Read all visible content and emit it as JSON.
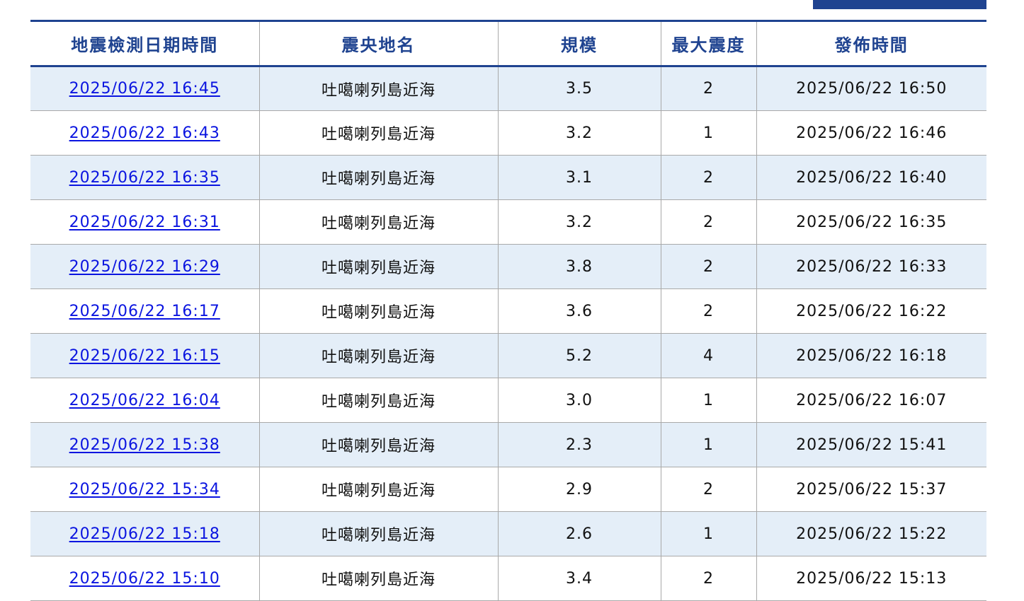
{
  "table": {
    "headers": [
      "地震檢測日期時間",
      "震央地名",
      "規模",
      "最大震度",
      "發佈時間"
    ],
    "rows": [
      {
        "detect_time": "2025/06/22 16:45",
        "location": "吐噶喇列島近海",
        "magnitude": "3.5",
        "max_intensity": "2",
        "publish_time": "2025/06/22 16:50"
      },
      {
        "detect_time": "2025/06/22 16:43",
        "location": "吐噶喇列島近海",
        "magnitude": "3.2",
        "max_intensity": "1",
        "publish_time": "2025/06/22 16:46"
      },
      {
        "detect_time": "2025/06/22 16:35",
        "location": "吐噶喇列島近海",
        "magnitude": "3.1",
        "max_intensity": "2",
        "publish_time": "2025/06/22 16:40"
      },
      {
        "detect_time": "2025/06/22 16:31",
        "location": "吐噶喇列島近海",
        "magnitude": "3.2",
        "max_intensity": "2",
        "publish_time": "2025/06/22 16:35"
      },
      {
        "detect_time": "2025/06/22 16:29",
        "location": "吐噶喇列島近海",
        "magnitude": "3.8",
        "max_intensity": "2",
        "publish_time": "2025/06/22 16:33"
      },
      {
        "detect_time": "2025/06/22 16:17",
        "location": "吐噶喇列島近海",
        "magnitude": "3.6",
        "max_intensity": "2",
        "publish_time": "2025/06/22 16:22"
      },
      {
        "detect_time": "2025/06/22 16:15",
        "location": "吐噶喇列島近海",
        "magnitude": "5.2",
        "max_intensity": "4",
        "publish_time": "2025/06/22 16:18"
      },
      {
        "detect_time": "2025/06/22 16:04",
        "location": "吐噶喇列島近海",
        "magnitude": "3.0",
        "max_intensity": "1",
        "publish_time": "2025/06/22 16:07"
      },
      {
        "detect_time": "2025/06/22 15:38",
        "location": "吐噶喇列島近海",
        "magnitude": "2.3",
        "max_intensity": "1",
        "publish_time": "2025/06/22 15:41"
      },
      {
        "detect_time": "2025/06/22 15:34",
        "location": "吐噶喇列島近海",
        "magnitude": "2.9",
        "max_intensity": "2",
        "publish_time": "2025/06/22 15:37"
      },
      {
        "detect_time": "2025/06/22 15:18",
        "location": "吐噶喇列島近海",
        "magnitude": "2.6",
        "max_intensity": "1",
        "publish_time": "2025/06/22 15:22"
      },
      {
        "detect_time": "2025/06/22 15:10",
        "location": "吐噶喇列島近海",
        "magnitude": "3.4",
        "max_intensity": "2",
        "publish_time": "2025/06/22 15:13"
      }
    ]
  },
  "colors": {
    "header_text": "#1f4390",
    "header_rule": "#1f4390",
    "stripe": "#e4eef8",
    "link": "#0a14e0"
  }
}
